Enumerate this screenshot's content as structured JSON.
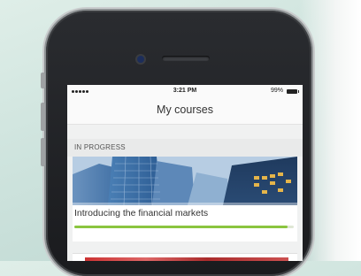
{
  "status_bar": {
    "signal_icon": "signal-dots-icon",
    "time": "3:21 PM",
    "battery_percent": "99%",
    "battery_icon": "battery-icon"
  },
  "nav": {
    "title": "My courses"
  },
  "sections": [
    {
      "header": "IN PROGRESS",
      "courses": [
        {
          "title": "Introducing the financial markets",
          "image": "skyscrapers-image",
          "progress_fraction": 0.97
        }
      ]
    }
  ],
  "colors": {
    "progress_fill": "#8bc53f",
    "progress_track": "#dfe7d5",
    "phone_body": "#1a1b1e"
  }
}
